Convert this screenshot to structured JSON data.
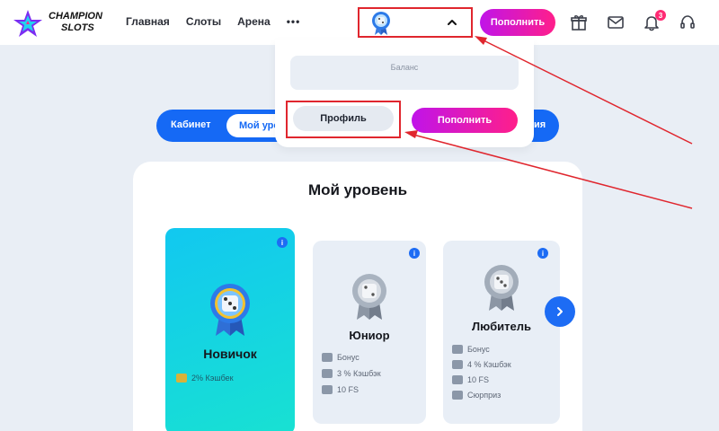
{
  "brand": {
    "line1": "CHAMPION",
    "line2": "SLOTS"
  },
  "nav": {
    "items": [
      "Главная",
      "Слоты",
      "Арена"
    ],
    "more": "•••"
  },
  "header": {
    "topup_label": "Пополнить",
    "notification_count": "3"
  },
  "dropdown": {
    "balance_label": "Баланс",
    "profile_label": "Профиль",
    "topup_label": "Пополнить"
  },
  "tabs": {
    "cabinet": "Кабинет",
    "my_level": "Мой уровень",
    "tail": "ия"
  },
  "main": {
    "title": "Мой уровень",
    "levels": [
      {
        "name": "Новичок",
        "perks": [
          "2% Кэшбек"
        ]
      },
      {
        "name": "Юниор",
        "perks": [
          "Бонус",
          "3 % Кэшбэк",
          "10 FS"
        ]
      },
      {
        "name": "Любитель",
        "perks": [
          "Бонус",
          "4 % Кэшбэк",
          "10 FS",
          "Сюрприз"
        ]
      }
    ],
    "info_symbol": "i"
  },
  "colors": {
    "accent_blue": "#1569f5",
    "gradient_pink_start": "#c014e9",
    "gradient_pink_end": "#ff1f8a",
    "annotation_red": "#e0262e",
    "active_card_start": "#12c8f0",
    "active_card_end": "#18e1d2"
  }
}
